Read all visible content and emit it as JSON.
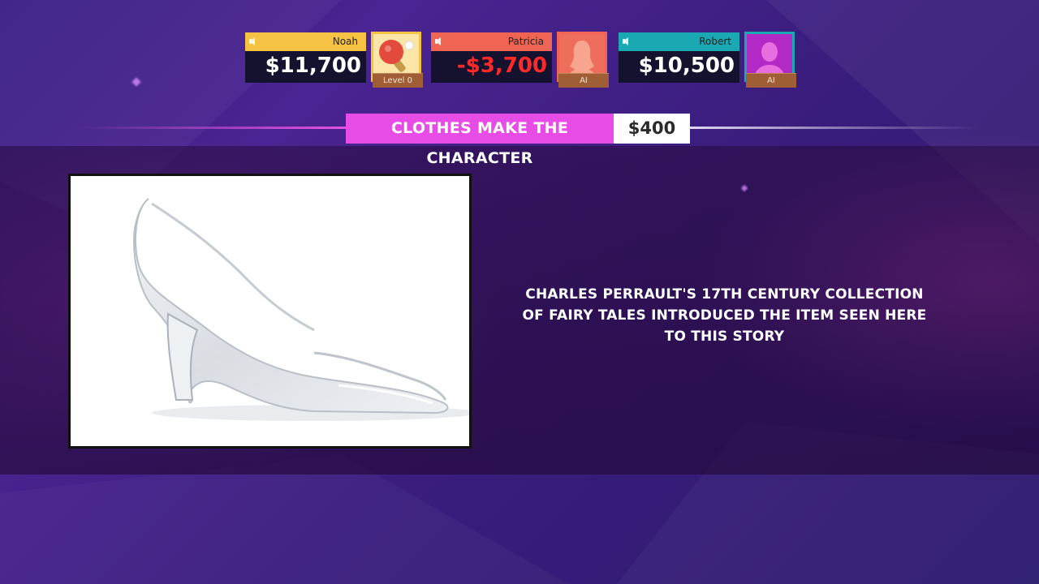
{
  "players": [
    {
      "name": "Noah",
      "score": "$11,700",
      "tag": "Level 0",
      "color": "#f6c243",
      "avatar": "paddle-icon",
      "negative": false
    },
    {
      "name": "Patricia",
      "score": "-$3,700",
      "tag": "AI",
      "color": "#ef6452",
      "avatar": "woman-silhouette-icon",
      "negative": true
    },
    {
      "name": "Robert",
      "score": "$10,500",
      "tag": "AI",
      "color": "#1aa8b3",
      "avatar": "man-silhouette-icon",
      "negative": false
    }
  ],
  "category": {
    "name": "CLOTHES MAKE THE CHARACTER",
    "value": "$400"
  },
  "clue": {
    "text": "CHARLES PERRAULT'S 17TH CENTURY COLLECTION OF FAIRY TALES INTRODUCED THE ITEM SEEN HERE TO THIS STORY"
  },
  "picture": {
    "subject": "glass-slipper"
  },
  "colors": {
    "category": "#e84ce6",
    "background": "#3b1f86"
  }
}
